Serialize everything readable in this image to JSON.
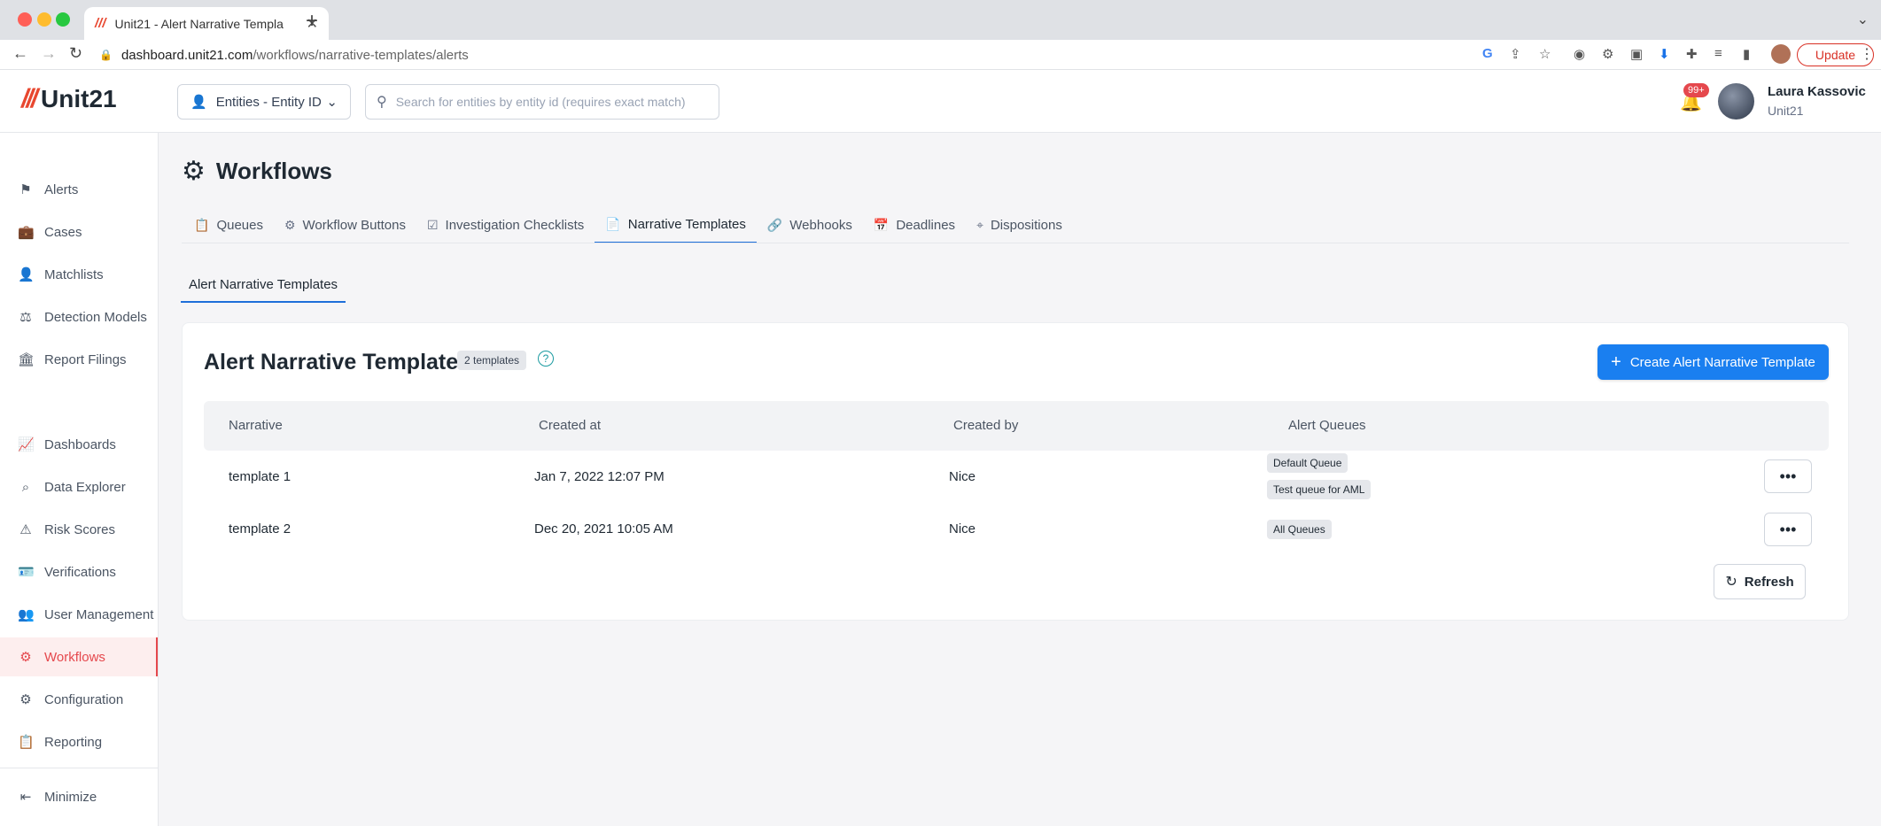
{
  "browser": {
    "tab_title": "Unit21 - Alert Narrative Templa",
    "tab_close": "✕",
    "new_tab": "+",
    "url_domain": "dashboard.unit21.com",
    "url_path": "/workflows/narrative-templates/alerts",
    "update_label": "Update"
  },
  "header": {
    "logo_text": "Unit21",
    "entity_select_value": "Entities - Entity ID",
    "search_placeholder": "Search for entities by entity id (requires exact match)",
    "notification_count": "99+",
    "user_name": "Laura Kassovic",
    "user_org": "Unit21"
  },
  "sidebar": {
    "items": [
      {
        "label": "Alerts",
        "icon": "flag-icon"
      },
      {
        "label": "Cases",
        "icon": "briefcase-icon"
      },
      {
        "label": "Matchlists",
        "icon": "user-plus-icon"
      },
      {
        "label": "Detection Models",
        "icon": "scale-icon"
      },
      {
        "label": "Report Filings",
        "icon": "bank-icon"
      },
      {
        "label": "Dashboards",
        "icon": "chart-line-icon"
      },
      {
        "label": "Data Explorer",
        "icon": "data-search-icon"
      },
      {
        "label": "Risk Scores",
        "icon": "warning-icon"
      },
      {
        "label": "Verifications",
        "icon": "id-card-icon"
      },
      {
        "label": "User Management",
        "icon": "users-icon"
      },
      {
        "label": "Workflows",
        "icon": "gear-icon",
        "active": true
      },
      {
        "label": "Configuration",
        "icon": "settings-icon"
      },
      {
        "label": "Reporting",
        "icon": "clipboard-icon"
      }
    ],
    "minimize_label": "Minimize"
  },
  "main": {
    "page_title": "Workflows",
    "tabs": [
      {
        "label": "Queues",
        "icon": "clipboard-icon"
      },
      {
        "label": "Workflow Buttons",
        "icon": "play-gear-icon"
      },
      {
        "label": "Investigation Checklists",
        "icon": "checklist-icon"
      },
      {
        "label": "Narrative Templates",
        "icon": "document-icon",
        "active": true
      },
      {
        "label": "Webhooks",
        "icon": "link-icon"
      },
      {
        "label": "Deadlines",
        "icon": "calendar-clock-icon"
      },
      {
        "label": "Dispositions",
        "icon": "map-pin-icon"
      }
    ],
    "subtab_label": "Alert Narrative Templates"
  },
  "card": {
    "title": "Alert Narrative Templates",
    "count_badge": "2 templates",
    "help": "?",
    "create_button_label": "Create Alert Narrative Template",
    "columns": [
      "Narrative",
      "Created at",
      "Created by",
      "Alert Queues"
    ],
    "rows": [
      {
        "narrative": "template 1",
        "created_at": "Jan 7, 2022 12:07 PM",
        "created_by": "Nice",
        "queues": [
          "Default Queue",
          "Test queue for AML"
        ]
      },
      {
        "narrative": "template 2",
        "created_at": "Dec 20, 2021 10:05 AM",
        "created_by": "Nice",
        "queues": [
          "All Queues"
        ]
      }
    ],
    "more_label": "•••",
    "refresh_label": "Refresh"
  }
}
